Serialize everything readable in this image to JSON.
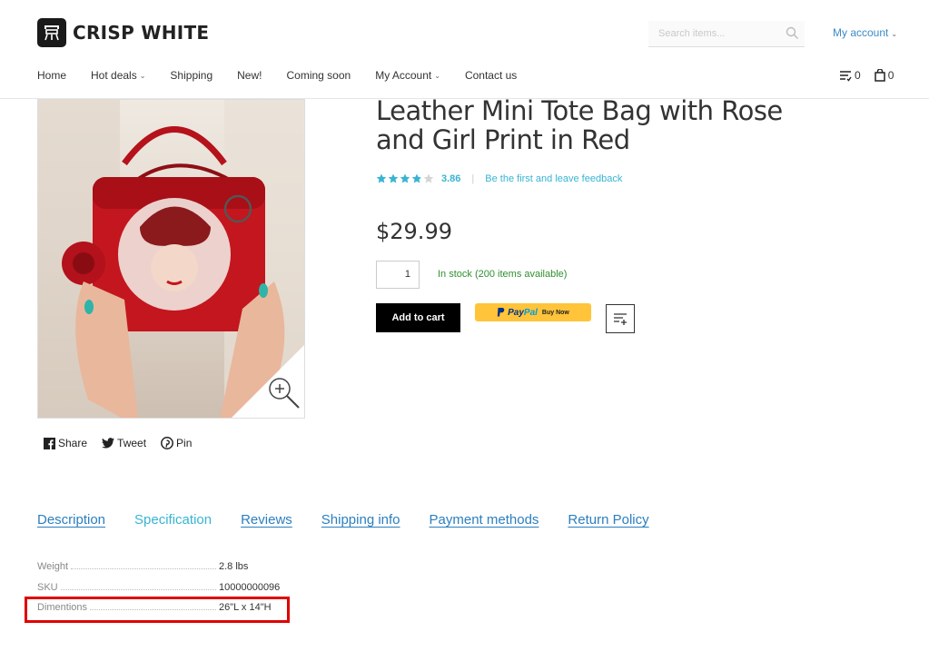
{
  "brand": {
    "name": "CRISP WHITE"
  },
  "search": {
    "placeholder": "Search items..."
  },
  "account": {
    "label": "My account"
  },
  "nav": {
    "items": [
      {
        "label": "Home",
        "dropdown": false
      },
      {
        "label": "Hot deals",
        "dropdown": true
      },
      {
        "label": "Shipping",
        "dropdown": false
      },
      {
        "label": "New!",
        "dropdown": false
      },
      {
        "label": "Coming soon",
        "dropdown": false
      },
      {
        "label": "My Account",
        "dropdown": true
      },
      {
        "label": "Contact us",
        "dropdown": false
      }
    ]
  },
  "header_counts": {
    "wishlist": "0",
    "cart": "0"
  },
  "product": {
    "title": "Leather Mini Tote Bag with Rose and Girl Print in Red",
    "rating_value": "3.86",
    "feedback_link": "Be the first and leave feedback",
    "price": "$29.99",
    "quantity": "1",
    "stock": "In stock (200 items available)",
    "add_to_cart": "Add to cart",
    "paypal": {
      "pay": "Pay",
      "pal": "Pal",
      "buy": "Buy Now"
    }
  },
  "share": {
    "facebook": "Share",
    "twitter": "Tweet",
    "pinterest": "Pin"
  },
  "tabs": [
    {
      "label": "Description",
      "active": false
    },
    {
      "label": "Specification",
      "active": true
    },
    {
      "label": "Reviews",
      "active": false
    },
    {
      "label": "Shipping info",
      "active": false
    },
    {
      "label": "Payment methods",
      "active": false
    },
    {
      "label": "Return Policy",
      "active": false
    }
  ],
  "specs": [
    {
      "label": "Weight",
      "value": "2.8 lbs"
    },
    {
      "label": "SKU",
      "value": "10000000096"
    },
    {
      "label": "Dimentions",
      "value": "26\"L x 14\"H"
    }
  ],
  "colors": {
    "accent": "#38b4d3",
    "link": "#2b7fbf",
    "stock": "#2f8f2f",
    "highlight": "#e00000"
  }
}
